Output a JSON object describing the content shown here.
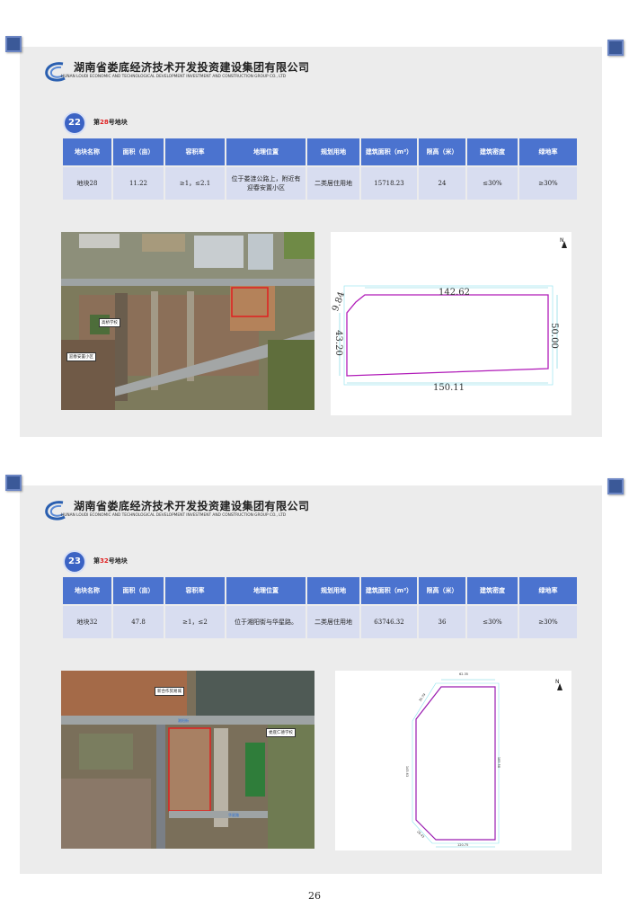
{
  "company": {
    "name_cn": "湖南省娄底经济技术开发投资建设集团有限公司",
    "name_en": "HUNAN LOUDI ECONOMIC AND TECHNOLOGICAL DEVELOPMENT INVESTMENT AND CONSTRUCTION GROUP CO., LTD"
  },
  "table_headers": [
    "地块名称",
    "面积（亩）",
    "容积率",
    "地理位置",
    "规划用地",
    "建筑面积（m²）",
    "限高（米）",
    "建筑密度",
    "绿地率"
  ],
  "plots": [
    {
      "index": "22",
      "title_pre": "第",
      "title_num": "28",
      "title_post": "号地块",
      "row": [
        "地块28",
        "11.22",
        "≥1，≤2.1",
        "位于娄涟公路上，附近有迎春安置小区",
        "二类居住用地",
        "15718.23",
        "24",
        "≤30%",
        "≥30%"
      ],
      "map_labels": {
        "school": "高桥学校",
        "community": "迎春安置小区"
      },
      "dimensions": {
        "top": "142.62",
        "right": "50.00",
        "bottom": "150.11",
        "left": "43.20",
        "corner": "9.84"
      },
      "north": "N"
    },
    {
      "index": "23",
      "title_pre": "第",
      "title_num": "32",
      "title_post": "号地块",
      "row": [
        "地块32",
        "47.8",
        "≥1，≤2",
        "位于湘阳街与华星路。",
        "二类居住用地",
        "63746.32",
        "36",
        "≤30%",
        "≥30%"
      ],
      "map_labels": {
        "market": "新合作贸易城",
        "school": "娄底仁德学校",
        "road1": "湘阳街",
        "road2": "华星路"
      },
      "dimensions": {
        "top": "62.35",
        "right": "185.58",
        "bottom": "120.75",
        "left": "145.63",
        "corner1": "35.79",
        "corner2": "28.43"
      },
      "north": "N"
    }
  ],
  "page_number": "26"
}
